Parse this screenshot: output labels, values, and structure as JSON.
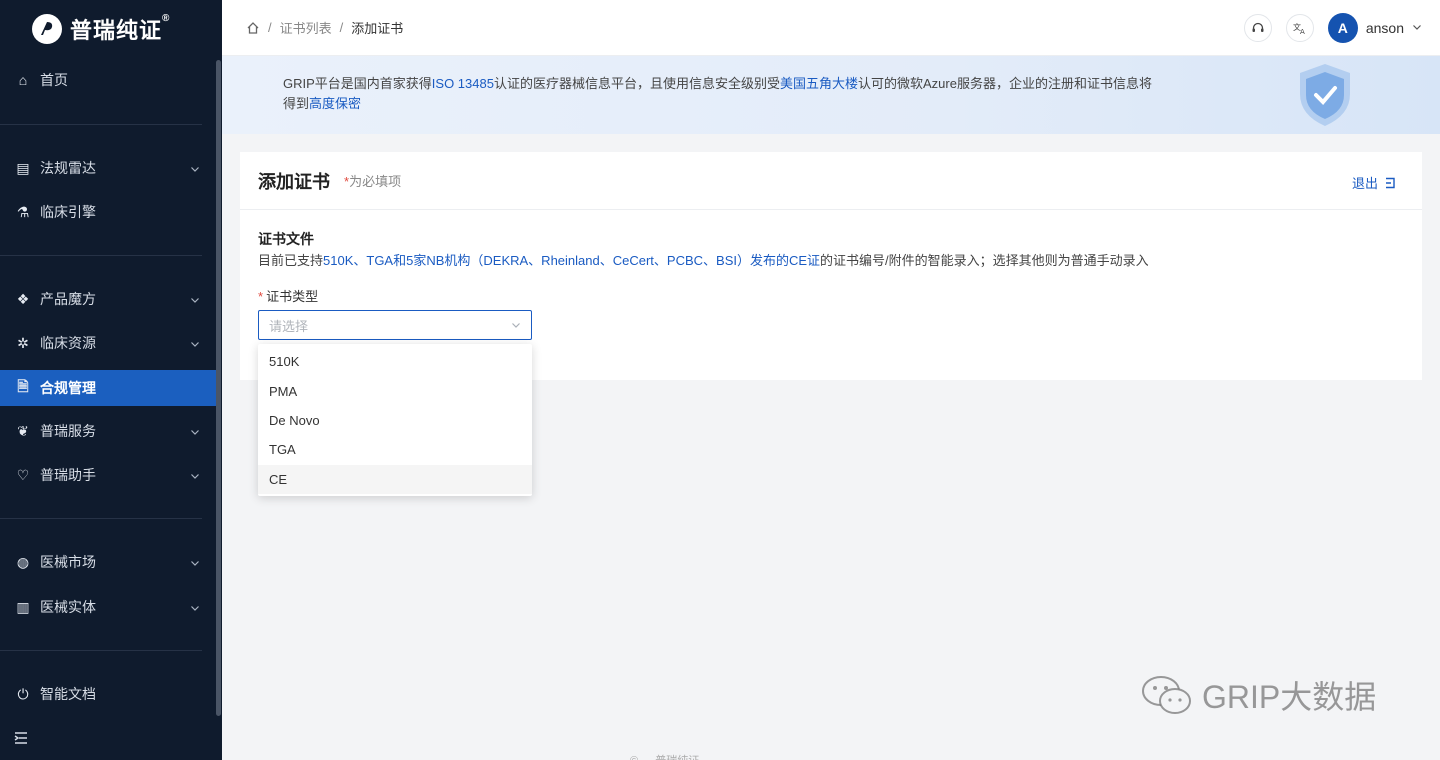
{
  "app": {
    "logo_text": "普瑞纯证",
    "logo_reg": "®"
  },
  "sidebar": {
    "items": [
      {
        "label": "首页",
        "icon": "home-icon",
        "glyph": "⌂",
        "chev": false
      },
      {
        "label": "法规雷达",
        "icon": "radar-icon",
        "glyph": "▤",
        "chev": true
      },
      {
        "label": "临床引擎",
        "icon": "flask-icon",
        "glyph": "⚗",
        "chev": false
      },
      {
        "label": "产品魔方",
        "icon": "cube-icon",
        "glyph": "❖",
        "chev": true
      },
      {
        "label": "临床资源",
        "icon": "gear-icon",
        "glyph": "✲",
        "chev": true
      },
      {
        "label": "合规管理",
        "icon": "document-icon",
        "glyph": "🗎",
        "chev": false,
        "active": true
      },
      {
        "label": "普瑞服务",
        "icon": "leaf-icon",
        "glyph": "❦",
        "chev": true
      },
      {
        "label": "普瑞助手",
        "icon": "heart-icon",
        "glyph": "♡",
        "chev": true
      },
      {
        "label": "医械市场",
        "icon": "globe-icon",
        "glyph": "◍",
        "chev": true
      },
      {
        "label": "医械实体",
        "icon": "building-icon",
        "glyph": "▥",
        "chev": true
      },
      {
        "label": "智能文档",
        "icon": "plug-icon",
        "glyph": "⏻",
        "chev": false
      }
    ],
    "collapse_icon": "menu-collapse-icon"
  },
  "header": {
    "breadcrumb": [
      "证书列表",
      "添加证书"
    ],
    "separator": "/",
    "support_icon": "headset-icon",
    "language_icon": "translate-icon",
    "avatar_letter": "A",
    "user_name": "anson"
  },
  "banner": {
    "part1": "GRIP平台是国内首家获得",
    "hl1": "ISO 13485",
    "part2": "认证的医疗器械信息平台，且使用信息安全级别受",
    "hl2": "美国五角大楼",
    "part3": "认可的微软Azure服务器，企业的注册和证书信息将得到",
    "hl3": "高度保密"
  },
  "card": {
    "title": "添加证书",
    "required_star": "*",
    "required_note": "为必填项",
    "exit_label": "退出",
    "section_title": "证书文件",
    "desc_part1": "目前已支持",
    "desc_hl": "510K、TGA和5家NB机构（DEKRA、Rheinland、CeCert、PCBC、BSI）发布的CE证",
    "desc_part2": "的证书编号/附件的智能录入；选择其他则为普通手动录入",
    "field_star": "*",
    "field_label": "证书类型",
    "select_placeholder": "请选择"
  },
  "dropdown": {
    "options": [
      "510K",
      "PMA",
      "De Novo",
      "TGA",
      "CE"
    ],
    "hovered_index": 4
  },
  "watermark": {
    "text": "GRIP大数据"
  },
  "footer": {
    "text": "© … 普瑞纯证 …"
  },
  "colors": {
    "sidebar_bg": "#0f1b2d",
    "accent": "#1b5fbf",
    "link": "#1a5bc2",
    "required": "#e04a3f"
  }
}
